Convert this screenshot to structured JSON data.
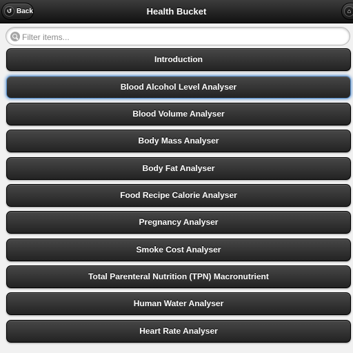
{
  "header": {
    "title": "Health Bucket",
    "back_label": "Back",
    "back_icon": "arrow-back-icon",
    "home_icon": "home-icon"
  },
  "filter": {
    "placeholder": "Filter items..."
  },
  "items": [
    {
      "label": "Introduction"
    },
    {
      "label": "Blood Alcohol Level Analyser"
    },
    {
      "label": "Blood Volume Analyser"
    },
    {
      "label": "Body Mass Analyser"
    },
    {
      "label": "Body Fat Analyser"
    },
    {
      "label": "Food Recipe Calorie Analyser"
    },
    {
      "label": "Pregnancy Analyser"
    },
    {
      "label": "Smoke Cost Analyser"
    },
    {
      "label": "Total Parenteral Nutrition (TPN) Macronutrient"
    },
    {
      "label": "Human Water Analyser"
    },
    {
      "label": "Heart Rate Analyser"
    }
  ],
  "colors": {
    "header_bg": "#1a1a1a",
    "item_bg": "#333333",
    "focus_ring": "#6fa0d8",
    "page_bg": "#f1f1f1"
  }
}
